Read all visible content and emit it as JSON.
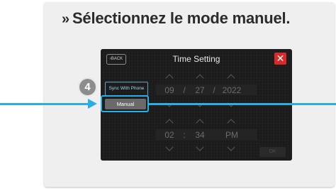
{
  "instruction": {
    "chevron": "»",
    "text": "Sélectionnez le mode manuel."
  },
  "screen": {
    "back_label": "BACK",
    "title": "Time Setting",
    "close_label": "✕",
    "sync_label": "Sync With Phone",
    "manual_label": "Manual",
    "ok_label": "OK",
    "date": {
      "month": "09",
      "sep1": "/",
      "day": "27",
      "sep2": "/",
      "year": "2022"
    },
    "time": {
      "hour": "02",
      "sep": ":",
      "minute": "34",
      "ampm": "PM"
    }
  },
  "step": {
    "number": "4"
  },
  "colors": {
    "accent": "#29aee6",
    "close_red": "#d92a2a"
  },
  "icons": {
    "back": "chevron-left-icon",
    "close": "close-icon",
    "up": "chevron-up-icon",
    "down": "chevron-down-icon"
  }
}
